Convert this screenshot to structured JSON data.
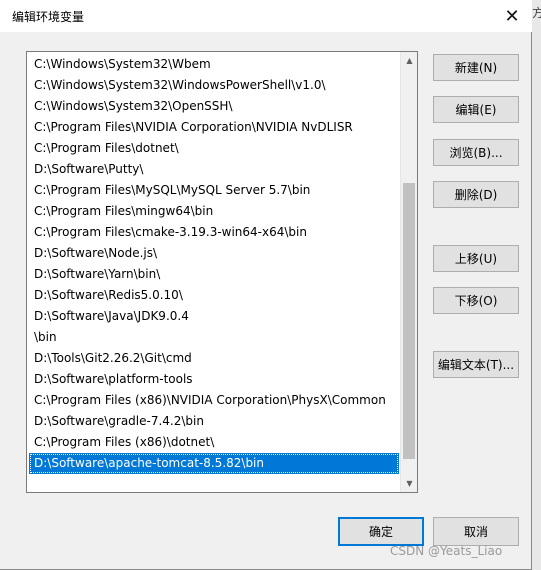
{
  "window": {
    "title": "编辑环境变量",
    "close_glyph": "✕"
  },
  "paths": [
    "C:\\Windows\\System32\\Wbem",
    "C:\\Windows\\System32\\WindowsPowerShell\\v1.0\\",
    "C:\\Windows\\System32\\OpenSSH\\",
    "C:\\Program Files\\NVIDIA Corporation\\NVIDIA NvDLISR",
    "C:\\Program Files\\dotnet\\",
    "D:\\Software\\Putty\\",
    "C:\\Program Files\\MySQL\\MySQL Server 5.7\\bin",
    "C:\\Program Files\\mingw64\\bin",
    "C:\\Program Files\\cmake-3.19.3-win64-x64\\bin",
    "D:\\Software\\Node.js\\",
    "D:\\Software\\Yarn\\bin\\",
    "D:\\Software\\Redis5.0.10\\",
    "D:\\Software\\Java\\JDK9.0.4",
    "\\bin",
    "D:\\Tools\\Git2.26.2\\Git\\cmd",
    "D:\\Software\\platform-tools",
    "C:\\Program Files (x86)\\NVIDIA Corporation\\PhysX\\Common",
    "D:\\Software\\gradle-7.4.2\\bin",
    "C:\\Program Files (x86)\\dotnet\\",
    "D:\\Software\\apache-tomcat-8.5.82\\bin"
  ],
  "selected_index": 19,
  "scroll": {
    "thumb_start": 0.28,
    "thumb_end": 0.96
  },
  "buttons": {
    "new": "新建(N)",
    "edit": "编辑(E)",
    "browse": "浏览(B)...",
    "delete": "删除(D)",
    "move_up": "上移(U)",
    "move_down": "下移(O)",
    "edit_text": "编辑文本(T)...",
    "ok": "确定",
    "cancel": "取消"
  },
  "watermark": "CSDN @Yeats_Liao",
  "side_fragment": "方",
  "colors": {
    "selection": "#0078d7",
    "default_button_border": "#0078d7"
  }
}
